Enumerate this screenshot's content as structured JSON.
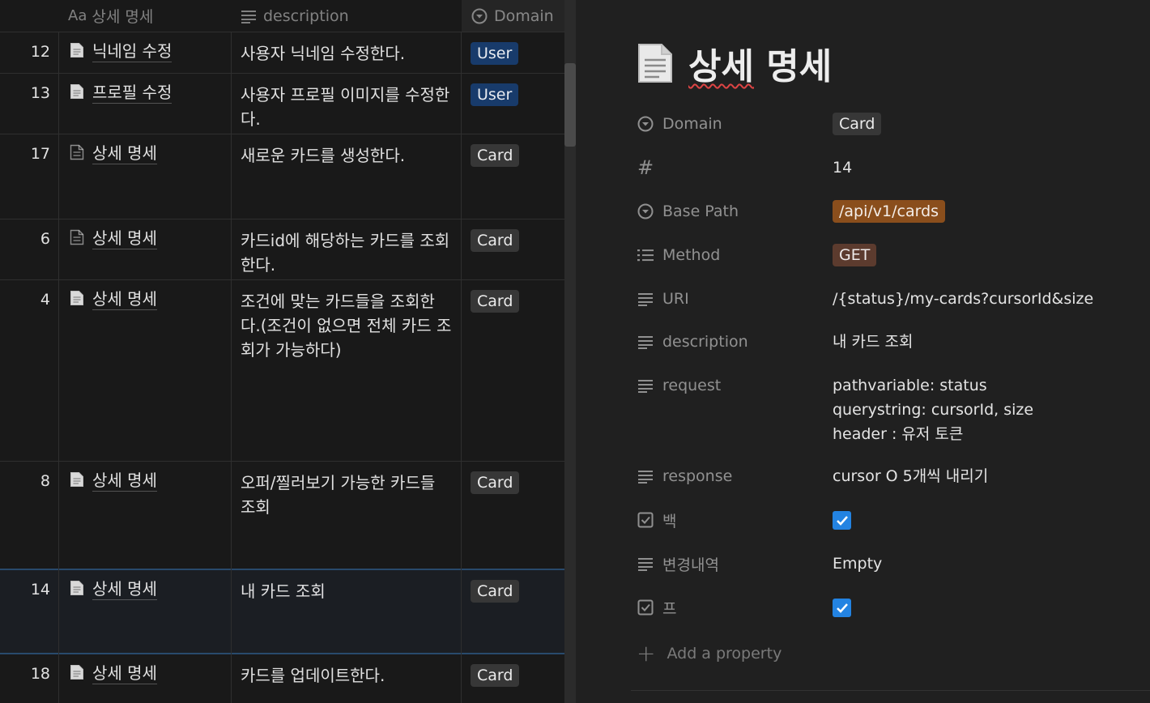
{
  "table": {
    "columns": {
      "title_prefix": "Aa",
      "title": "상세 명세",
      "description": "description",
      "domain": "Domain"
    },
    "rows": [
      {
        "num": "12",
        "title": "닉네임 수정",
        "description": "사용자 닉네임 수정한다.",
        "domain": "User"
      },
      {
        "num": "13",
        "title": "프로필 수정",
        "description": "사용자 프로필 이미지를 수정한다.",
        "domain": "User"
      },
      {
        "num": "17",
        "title": "상세 명세",
        "description": "새로운 카드를 생성한다.",
        "domain": "Card"
      },
      {
        "num": "6",
        "title": "상세 명세",
        "description": "카드id에 해당하는 카드를 조회한다.",
        "domain": "Card"
      },
      {
        "num": "4",
        "title": "상세 명세",
        "description": "조건에 맞는 카드들을 조회한다.(조건이 없으면 전체 카드 조회가 가능하다)",
        "domain": "Card"
      },
      {
        "num": "8",
        "title": "상세 명세",
        "description": "오퍼/찔러보기 가능한 카드들 조회",
        "domain": "Card"
      },
      {
        "num": "14",
        "title": "상세 명세",
        "description": "내 카드 조회",
        "domain": "Card"
      },
      {
        "num": "18",
        "title": "상세 명세",
        "description": "카드를 업데이트한다.",
        "domain": "Card"
      }
    ]
  },
  "detail": {
    "title": "상세 명세",
    "properties": {
      "domain": {
        "label": "Domain",
        "value": "Card"
      },
      "number": {
        "label": "#",
        "value": "14"
      },
      "base_path": {
        "label": "Base Path",
        "value": "/api/v1/cards"
      },
      "method": {
        "label": "Method",
        "value": "GET"
      },
      "uri": {
        "label": "URI",
        "value": "/{status}/my-cards?cursorId&size"
      },
      "description": {
        "label": "description",
        "value": "내 카드 조회"
      },
      "request": {
        "label": "request",
        "lines": [
          "pathvariable: status",
          "querystring: cursorId, size",
          "header : 유저 토큰"
        ]
      },
      "response": {
        "label": "response",
        "value": "cursor O 5개씩 내리기"
      },
      "back": {
        "label": "백",
        "checked": true
      },
      "changes": {
        "label": "변경내역",
        "value": "Empty"
      },
      "front": {
        "label": "프",
        "checked": true
      }
    },
    "add_property": "Add a property"
  },
  "colors": {
    "user_tag": "#183b6b",
    "card_tag": "#373737",
    "base_path_tag": "#8a4e1c",
    "method_tag": "#5c3b2e",
    "checkbox": "#2383e2",
    "selection_border": "#294a6c"
  }
}
